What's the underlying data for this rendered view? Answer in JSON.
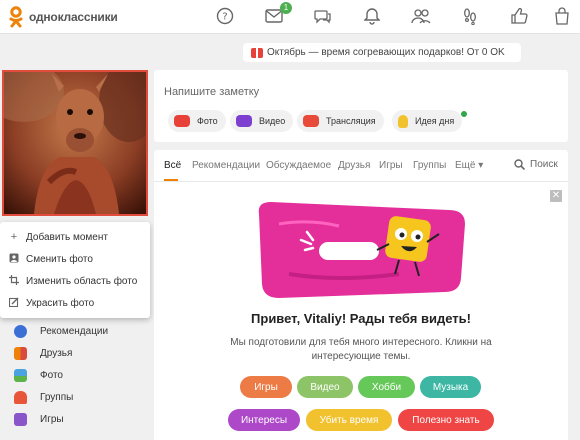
{
  "header": {
    "logo_text": "одноклассники",
    "messages_badge": "1"
  },
  "promo": {
    "text": "Октябрь — время согревающих подарков! От 0 OK"
  },
  "avatar_menu": {
    "items": [
      {
        "label": "Добавить момент",
        "icon": "plus-icon"
      },
      {
        "label": "Сменить фото",
        "icon": "photo-icon"
      },
      {
        "label": "Изменить область фото",
        "icon": "crop-icon"
      },
      {
        "label": "Украсить фото",
        "icon": "edit-icon"
      }
    ]
  },
  "sidebar": {
    "items": [
      {
        "label": "Рекомендации",
        "icon": "compass-icon"
      },
      {
        "label": "Друзья",
        "icon": "friends-icon"
      },
      {
        "label": "Фото",
        "icon": "photo-icon"
      },
      {
        "label": "Группы",
        "icon": "groups-icon"
      },
      {
        "label": "Игры",
        "icon": "games-icon"
      }
    ]
  },
  "note": {
    "placeholder": "Напишите заметку",
    "chips": [
      {
        "label": "Фото",
        "icon": "camera-icon"
      },
      {
        "label": "Видео",
        "icon": "video-icon"
      },
      {
        "label": "Трансляция",
        "icon": "broadcast-icon"
      },
      {
        "label": "Идея дня",
        "icon": "bulb-icon"
      }
    ]
  },
  "feed": {
    "tabs": [
      "Всё",
      "Рекомендации",
      "Обсуждаемое",
      "Друзья",
      "Игры",
      "Группы",
      "Ещё ▾"
    ],
    "search_label": "Поиск",
    "greeting": "Привет, Vitaliy! Рады тебя видеть!",
    "subtitle_line1": "Мы подготовили для тебя много интересного. Кликни на",
    "subtitle_line2": "интересующие темы.",
    "topics": [
      {
        "label": "Игры",
        "color": "#ec7b46"
      },
      {
        "label": "Видео",
        "color": "#8dc467"
      },
      {
        "label": "Хобби",
        "color": "#67c85a"
      },
      {
        "label": "Музыка",
        "color": "#3db7a4"
      },
      {
        "label": "Интересы",
        "color": "#ad49c9"
      },
      {
        "label": "Убить время",
        "color": "#f2c12e"
      },
      {
        "label": "Полезно знать",
        "color": "#ef4545"
      }
    ]
  },
  "colors": {
    "brand_orange": "#ee8208",
    "avatar_border": "#e24c3c"
  }
}
